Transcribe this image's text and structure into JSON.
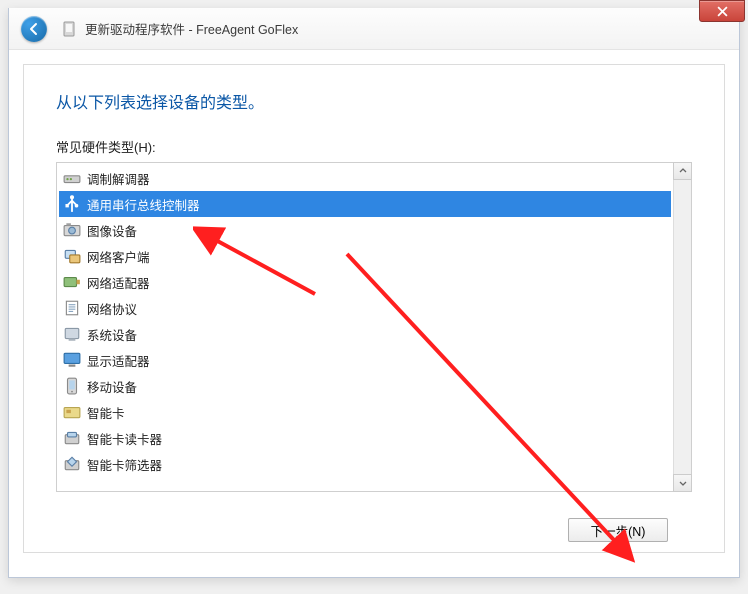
{
  "header": {
    "title": "更新驱动程序软件 - FreeAgent GoFlex"
  },
  "page": {
    "heading": "从以下列表选择设备的类型。",
    "list_label": "常见硬件类型(H):"
  },
  "items": [
    {
      "icon": "modem",
      "label": "调制解调器"
    },
    {
      "icon": "usb",
      "label": "通用串行总线控制器",
      "selected": true
    },
    {
      "icon": "imaging",
      "label": "图像设备"
    },
    {
      "icon": "netclient",
      "label": "网络客户端"
    },
    {
      "icon": "netadapter",
      "label": "网络适配器"
    },
    {
      "icon": "netproto",
      "label": "网络协议"
    },
    {
      "icon": "system",
      "label": "系统设备"
    },
    {
      "icon": "display",
      "label": "显示适配器"
    },
    {
      "icon": "mobile",
      "label": "移动设备"
    },
    {
      "icon": "smartcard",
      "label": "智能卡"
    },
    {
      "icon": "screader",
      "label": "智能卡读卡器"
    },
    {
      "icon": "scfilter",
      "label": "智能卡筛选器"
    }
  ],
  "footer": {
    "next_label": "下一步(N)"
  }
}
